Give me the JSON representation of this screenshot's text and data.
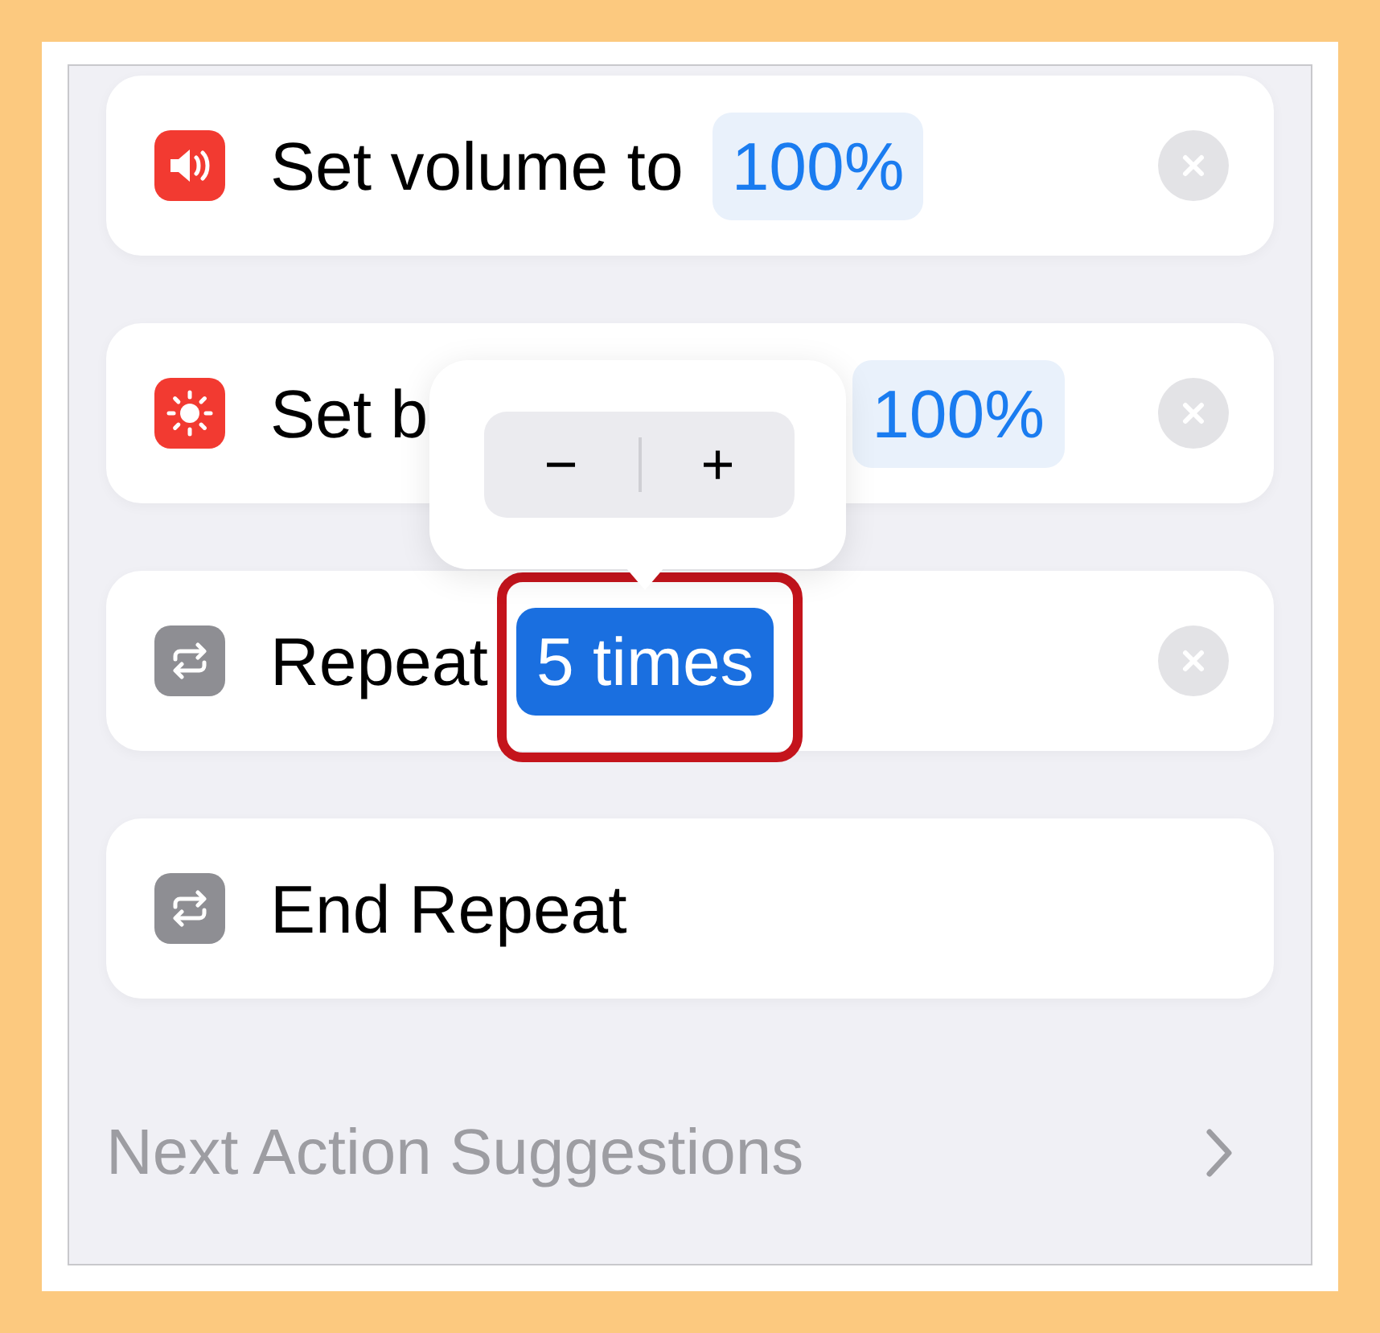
{
  "actions": [
    {
      "kind": "volume",
      "label": "Set volume to",
      "value": "100%",
      "selected": false,
      "removable": true
    },
    {
      "kind": "brightness",
      "label": "Set b",
      "value": "100%",
      "selected": false,
      "removable": true
    },
    {
      "kind": "repeat",
      "label": "Repeat",
      "value": "5 times",
      "selected": true,
      "removable": true
    },
    {
      "kind": "repeat",
      "label": "End Repeat",
      "removable": false
    }
  ],
  "stepper": {
    "minus": "−",
    "plus": "+"
  },
  "next_suggestions": {
    "label": "Next Action Suggestions"
  }
}
